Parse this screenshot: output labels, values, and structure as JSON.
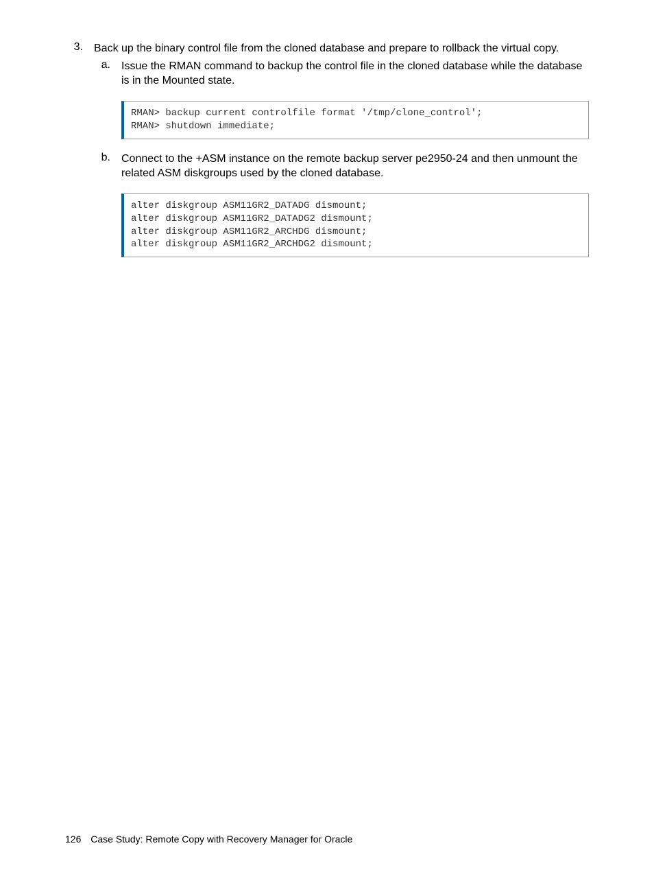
{
  "step3": {
    "number": "3.",
    "text": "Back up the binary control file from the cloned database and prepare to rollback the virtual copy.",
    "substep_a": {
      "letter": "a.",
      "text": "Issue the RMAN command to backup the control file in the cloned database while the database is in the Mounted state.",
      "code": "RMAN> backup current controlfile format '/tmp/clone_control';\nRMAN> shutdown immediate;"
    },
    "substep_b": {
      "letter": "b.",
      "text": "Connect to the +ASM instance on the remote backup server pe2950-24 and then unmount the related ASM diskgroups used by the cloned database.",
      "code": "alter diskgroup ASM11GR2_DATADG dismount;\nalter diskgroup ASM11GR2_DATADG2 dismount;\nalter diskgroup ASM11GR2_ARCHDG dismount;\nalter diskgroup ASM11GR2_ARCHDG2 dismount;"
    }
  },
  "footer": {
    "page": "126",
    "title": "Case Study: Remote Copy with Recovery Manager for Oracle"
  }
}
